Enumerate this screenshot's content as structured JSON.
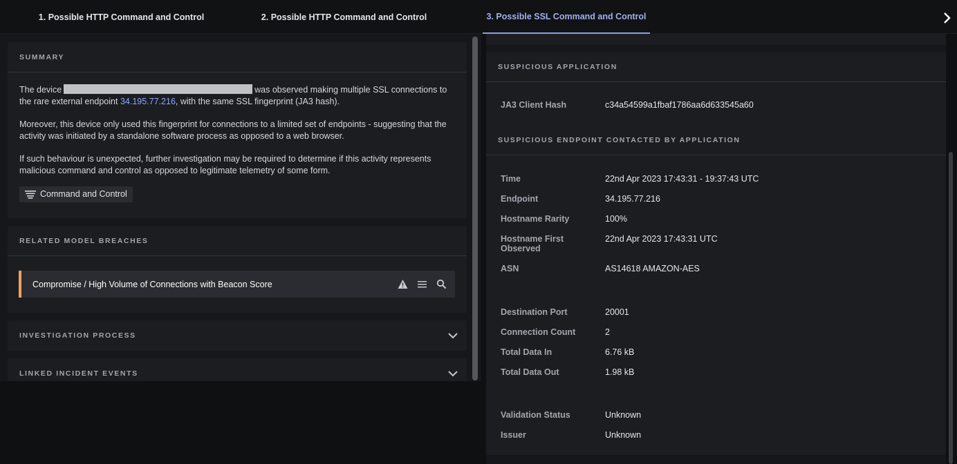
{
  "tabs": [
    {
      "label": "1. Possible HTTP Command and Control"
    },
    {
      "label": "2. Possible HTTP Command and Control"
    },
    {
      "label": "3. Possible SSL Command and Control"
    }
  ],
  "summary": {
    "title": "SUMMARY",
    "p1_pre": "The device",
    "p1_mid": "was observed making multiple SSL connections to the rare external endpoint",
    "p1_link": "34.195.77.216",
    "p1_post": ", with the same SSL fingerprint (JA3 hash).",
    "p2": "Moreover, this device only used this fingerprint for connections to a limited set of endpoints - suggesting that the activity was initiated by a standalone software process as opposed to a web browser.",
    "p3": "If such behaviour is unexpected, further investigation may be required to determine if this activity represents malicious command and control as opposed to legitimate telemetry of some form.",
    "tag": "Command and Control"
  },
  "related": {
    "title": "RELATED MODEL BREACHES",
    "breach_name": "Compromise / High Volume of Connections with Beacon Score",
    "accent_color": "#f4a160"
  },
  "investigation": {
    "title": "INVESTIGATION PROCESS"
  },
  "linked_events": {
    "title": "LINKED INCIDENT EVENTS"
  },
  "app": {
    "title": "SUSPICIOUS APPLICATION",
    "ja3_label": "JA3 Client Hash",
    "ja3_value": "c34a54599a1fbaf1786aa6d633545a60"
  },
  "endpoint": {
    "title": "SUSPICIOUS ENDPOINT CONTACTED BY APPLICATION",
    "rows": [
      {
        "k": "Time",
        "v": "22nd Apr 2023 17:43:31 - 19:37:43 UTC"
      },
      {
        "k": "Endpoint",
        "v": "34.195.77.216"
      },
      {
        "k": "Hostname Rarity",
        "v": "100%"
      },
      {
        "k": "Hostname First Observed",
        "v": "22nd Apr 2023 17:43:31 UTC"
      },
      {
        "k": "ASN",
        "v": "AS14618 AMAZON-AES"
      },
      {
        "k": "Destination Port",
        "v": "20001"
      },
      {
        "k": "Connection Count",
        "v": "2"
      },
      {
        "k": "Total Data In",
        "v": "6.76 kB"
      },
      {
        "k": "Total Data Out",
        "v": "1.98 kB"
      },
      {
        "k": "Validation Status",
        "v": "Unknown"
      },
      {
        "k": "Issuer",
        "v": "Unknown"
      }
    ]
  }
}
